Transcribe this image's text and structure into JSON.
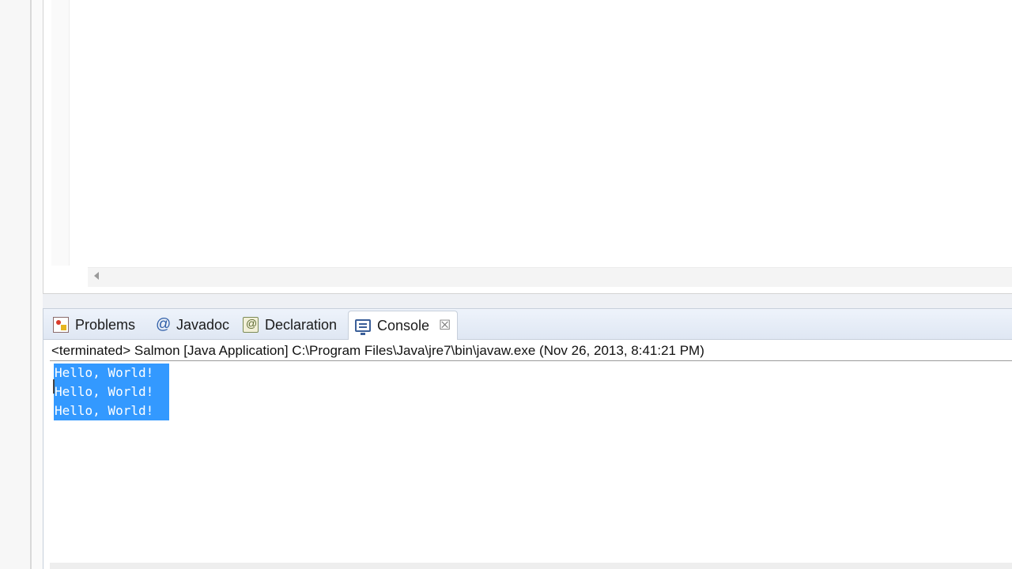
{
  "tabs": [
    {
      "label": "Problems",
      "icon": "problems-icon",
      "active": false
    },
    {
      "label": "Javadoc",
      "icon": "javadoc-icon",
      "active": false
    },
    {
      "label": "Declaration",
      "icon": "declaration-icon",
      "active": false
    },
    {
      "label": "Console",
      "icon": "console-icon",
      "active": true
    }
  ],
  "console": {
    "header": "<terminated> Salmon [Java Application] C:\\Program Files\\Java\\jre7\\bin\\javaw.exe (Nov 26, 2013, 8:41:21 PM)",
    "lines": [
      "Hello, World!",
      "Hello, World!",
      "Hello, World!"
    ],
    "selection_color": "#3399ff"
  },
  "colors": {
    "tab_bar": "#dfe7f3",
    "tab_border": "#c7cfdb"
  }
}
